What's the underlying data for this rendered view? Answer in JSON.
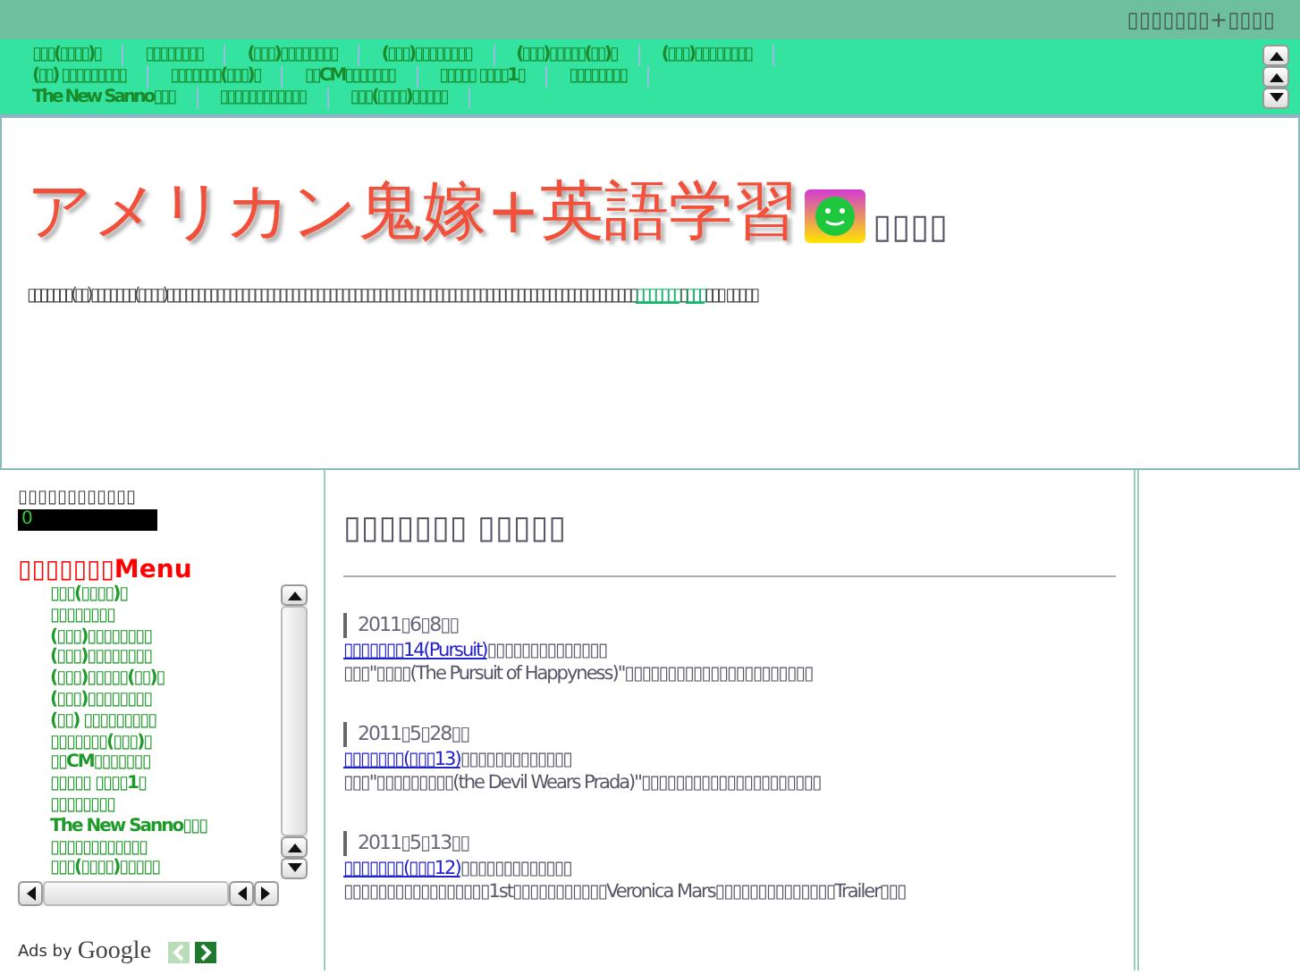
{
  "top_bar": {
    "title": "▯▯▯▯▯▯▯+▯▯▯▯"
  },
  "nav": {
    "rows": [
      [
        "▯▯▯(▯▯▯▯)▯",
        "▯▯▯▯▯▯▯▯",
        "(▯▯▯)▯▯▯▯▯▯▯▯",
        "(▯▯▯)▯▯▯▯▯▯▯▯",
        "(▯▯▯)▯▯▯▯▯(▯▯)▯",
        "(▯▯▯)▯▯▯▯▯▯▯▯"
      ],
      [
        "(▯▯) ▯▯▯▯▯▯▯▯▯",
        "▯▯▯▯▯▯▯(▯▯▯)▯",
        "▯▯CM▯▯▯▯▯▯▯",
        "▯▯▯▯▯ ▯▯▯▯1▯",
        "▯▯▯▯▯▯▯▯"
      ],
      [
        "The New Sanno▯▯▯",
        "▯▯▯▯▯▯▯▯▯▯▯▯",
        "▯▯▯(▯▯▯▯)▯▯▯▯▯"
      ]
    ]
  },
  "header": {
    "title": "アメリカン鬼嫁+英語学習",
    "subtitle": "▯▯▯▯",
    "description": {
      "before": "▯▯▯▯▯▯▯(▯▯)▯▯▯▯▯▯▯(▯▯▯▯)▯▯▯▯▯▯▯▯▯▯▯▯▯▯▯▯▯▯▯▯▯▯▯▯▯▯▯▯▯▯▯▯▯▯▯▯▯▯▯▯▯▯▯▯▯▯▯▯▯▯▯▯▯▯▯▯▯▯▯▯▯▯▯▯▯▯▯▯▯▯▯▯▯▯▯",
      "link_1": "▯▯▯▯▯▯▯",
      "between": "▯",
      "link_2": "▯▯▯",
      "after": "▯▯▯ ▯▯▯▯▯"
    }
  },
  "sidebar": {
    "counter_label": "▯▯▯▯▯▯▯▯▯▯▯▯",
    "counter_value": "0",
    "menu_title": "▯▯▯▯▯▯▯Menu",
    "menu_items": [
      "▯▯▯(▯▯▯▯)▯",
      "▯▯▯▯▯▯▯▯",
      "(▯▯▯)▯▯▯▯▯▯▯▯",
      "(▯▯▯)▯▯▯▯▯▯▯▯",
      "(▯▯▯)▯▯▯▯▯(▯▯)▯",
      "(▯▯▯)▯▯▯▯▯▯▯▯",
      "(▯▯) ▯▯▯▯▯▯▯▯▯",
      "▯▯▯▯▯▯▯(▯▯▯)▯",
      "▯▯CM▯▯▯▯▯▯▯",
      "▯▯▯▯▯ ▯▯▯▯1▯",
      "▯▯▯▯▯▯▯▯",
      "The New Sanno▯▯▯",
      "▯▯▯▯▯▯▯▯▯▯▯▯",
      "▯▯▯(▯▯▯▯)▯▯▯▯▯"
    ],
    "ads_label": "Ads by",
    "ads_brand": "Google"
  },
  "main": {
    "heading": "▯▯▯▯▯▯▯ ▯▯▯▯▯",
    "entries": [
      {
        "date": "2011▯6▯8▯▯",
        "link": "▯▯▯▯▯▯▯14(Pursuit)",
        "title_rest": "▯▯▯▯▯▯▯▯▯▯▯▯▯▯",
        "summary": "▯▯▯\"▯▯▯▯(The Pursuit of Happyness)\"▯▯▯▯▯▯▯▯▯▯▯▯▯▯▯▯▯▯▯▯▯▯"
      },
      {
        "date": "2011▯5▯28▯▯",
        "link": "▯▯▯▯▯▯▯(▯▯▯13)",
        "title_rest": "▯▯▯▯▯▯▯▯▯▯▯▯▯",
        "summary": "▯▯▯\"▯▯▯▯▯▯▯▯▯(the Devil Wears Prada)\"▯▯▯▯▯▯▯▯▯▯▯▯▯▯▯▯▯▯▯▯▯"
      },
      {
        "date": "2011▯5▯13▯▯",
        "link": "▯▯▯▯▯▯▯(▯▯▯12)",
        "title_rest": "▯▯▯▯▯▯▯▯▯▯▯▯▯",
        "summary": "▯▯▯▯▯▯▯▯▯▯▯▯▯▯▯▯▯1st▯▯▯▯▯▯▯▯▯▯▯Veronica Mars▯▯▯▯▯▯▯▯▯▯▯▯▯▯Trailer▯▯▯"
      }
    ]
  }
}
